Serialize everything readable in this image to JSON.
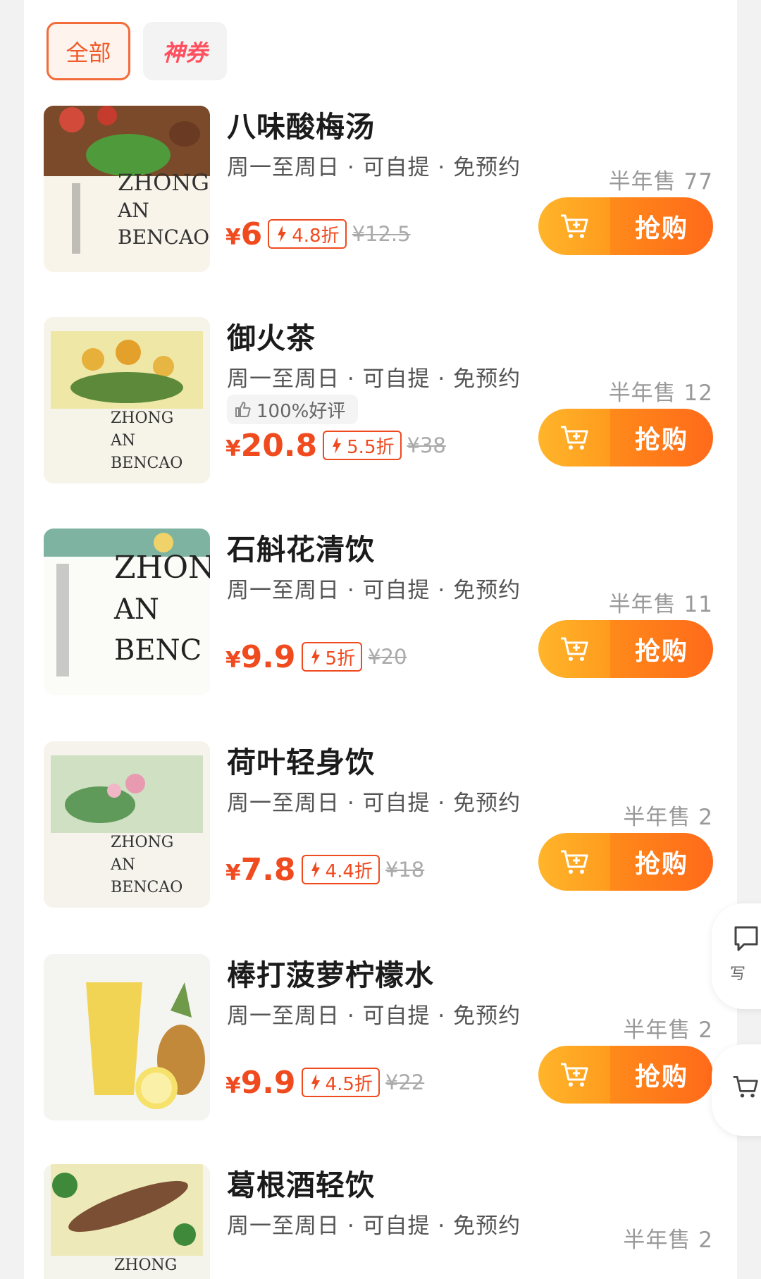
{
  "tabs": {
    "all": "全部",
    "coupon": "神券"
  },
  "items": [
    {
      "name": "八味酸梅汤",
      "meta": "周一至周日 · 可自提 · 免预约",
      "sold": "半年售 77",
      "price": "6",
      "discount": "4.8折",
      "original": "¥12.5",
      "rating": "",
      "buy": "抢购"
    },
    {
      "name": "御火茶",
      "meta": "周一至周日 · 可自提 · 免预约",
      "sold": "半年售 12",
      "price": "20.8",
      "discount": "5.5折",
      "original": "¥38",
      "rating": "100%好评",
      "buy": "抢购"
    },
    {
      "name": "石斛花清饮",
      "meta": "周一至周日 · 可自提 · 免预约",
      "sold": "半年售 11",
      "price": "9.9",
      "discount": "5折",
      "original": "¥20",
      "rating": "",
      "buy": "抢购"
    },
    {
      "name": "荷叶轻身饮",
      "meta": "周一至周日 · 可自提 · 免预约",
      "sold": "半年售 2",
      "price": "7.8",
      "discount": "4.4折",
      "original": "¥18",
      "rating": "",
      "buy": "抢购"
    },
    {
      "name": "棒打菠萝柠檬水",
      "meta": "周一至周日 · 可自提 · 免预约",
      "sold": "半年售 2",
      "price": "9.9",
      "discount": "4.5折",
      "original": "¥22",
      "rating": "",
      "buy": "抢购"
    },
    {
      "name": "葛根酒轻饮",
      "meta": "周一至周日 · 可自提 · 免预约",
      "sold": "半年售 2",
      "price": "",
      "discount": "",
      "original": "",
      "rating": "",
      "buy": ""
    }
  ],
  "yen": "¥",
  "floating": {
    "write_review": "写"
  },
  "colors": {
    "accent": "#f04a1f",
    "buy_orange": "#ff7a1a",
    "cart_yellow": "#ffb52a"
  },
  "icons": [
    "cart-plus-icon",
    "down-arrow-icon",
    "thumbs-up-icon",
    "comment-icon"
  ]
}
